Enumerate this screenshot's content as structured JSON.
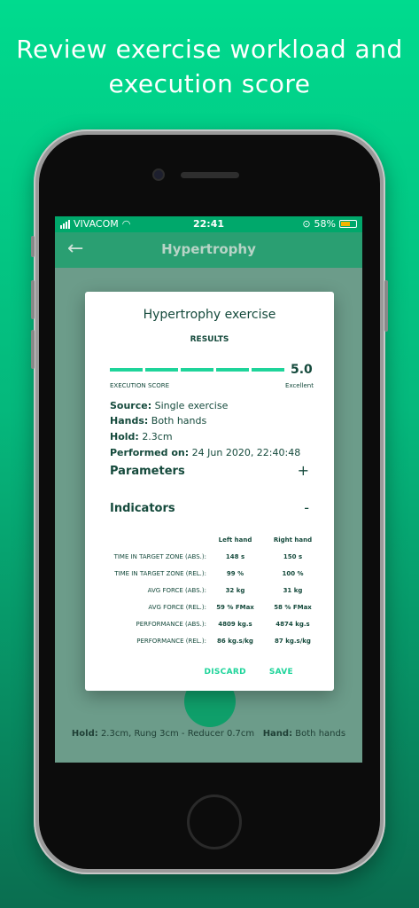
{
  "headline": {
    "line1": "Review exercise workload and",
    "line2": "execution score"
  },
  "status_bar": {
    "carrier": "VIVACOM",
    "time": "22:41",
    "battery": "58%"
  },
  "app_bar": {
    "title": "Hypertrophy"
  },
  "bottom_info": {
    "hold_label": "Hold:",
    "hold_value": "2.3cm, Rung 3cm - Reducer 0.7cm",
    "hand_label": "Hand:",
    "hand_value": "Both hands"
  },
  "dialog": {
    "title": "Hypertrophy exercise",
    "subtitle": "RESULTS",
    "score": {
      "value": "5.0",
      "label": "EXECUTION SCORE",
      "rating": "Excellent",
      "segments_filled": 5,
      "segments_total": 5
    },
    "info": [
      {
        "label": "Source:",
        "value": "Single exercise"
      },
      {
        "label": "Hands:",
        "value": "Both hands"
      },
      {
        "label": "Hold:",
        "value": "2.3cm"
      },
      {
        "label": "Performed on:",
        "value": "24 Jun 2020, 22:40:48"
      }
    ],
    "parameters": {
      "title": "Parameters",
      "sign": "+"
    },
    "indicators": {
      "title": "Indicators",
      "sign": "-",
      "columns": [
        "Left hand",
        "Right hand"
      ],
      "rows": [
        {
          "label": "TIME IN TARGET ZONE (ABS.):",
          "left": "148 s",
          "right": "150 s"
        },
        {
          "label": "TIME IN TARGET ZONE (REL.):",
          "left": "99 %",
          "right": "100 %"
        },
        {
          "label": "AVG FORCE (ABS.):",
          "left": "32 kg",
          "right": "31 kg"
        },
        {
          "label": "AVG FORCE (REL.):",
          "left": "59 % FMax",
          "right": "58 % FMax"
        },
        {
          "label": "PERFORMANCE (ABS.):",
          "left": "4809 kg.s",
          "right": "4874 kg.s"
        },
        {
          "label": "PERFORMANCE (REL.):",
          "left": "86 kg.s/kg",
          "right": "87 kg.s/kg"
        }
      ]
    },
    "actions": {
      "discard": "DISCARD",
      "save": "SAVE"
    }
  },
  "colors": {
    "accent": "#1ed49a",
    "app_bar": "#2a9f72",
    "text": "#154a3c"
  }
}
